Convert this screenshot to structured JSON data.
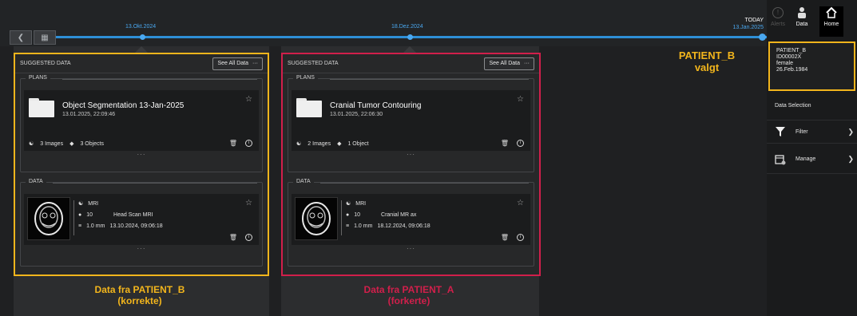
{
  "timeline": {
    "date_1": "13.Okt.2024",
    "date_2": "18.Dez.2024",
    "today_label": "TODAY",
    "today_date": "13.Jan.2025"
  },
  "topnav": {
    "alerts": "Alerts",
    "data": "Data",
    "home": "Home"
  },
  "patient": {
    "name": "PATIENT_B",
    "id": "ID00002X",
    "sex": "female",
    "dob": "26.Feb.1984"
  },
  "right_menu": {
    "data_selection": "Data Selection",
    "filter": "Filter",
    "manage": "Manage"
  },
  "panels": [
    {
      "header": "SUGGESTED DATA",
      "see_all": "See All Data",
      "plans_title": "PLANS",
      "plan_title": "Object Segmentation 13-Jan-2025",
      "plan_date": "13.01.2025, 22:09:46",
      "plan_images": "3 Images",
      "plan_objects": "3 Objects",
      "data_title": "DATA",
      "modality": "MRI",
      "count": "10",
      "series_name": "Head Scan MRI",
      "thickness": "1.0 mm",
      "series_date": "13.10.2024, 09:06:18"
    },
    {
      "header": "SUGGESTED DATA",
      "see_all": "See All Data",
      "plans_title": "PLANS",
      "plan_title": "Cranial Tumor Contouring",
      "plan_date": "13.01.2025, 22:06:30",
      "plan_images": "2 Images",
      "plan_objects": "1 Object",
      "data_title": "DATA",
      "modality": "MRI",
      "count": "10",
      "series_name": "Cranial MR ax",
      "thickness": "1.0 mm",
      "series_date": "18.12.2024, 09:06:18"
    }
  ],
  "annotations": {
    "patient_b_selected_1": "PATIENT_B",
    "patient_b_selected_2": "valgt",
    "left_1": "Data fra PATIENT_B",
    "left_2": "(korrekte)",
    "right_1": "Data fra PATIENT_A",
    "right_2": "(forkerte)"
  },
  "colors": {
    "highlight_correct": "#f2b51c",
    "highlight_wrong": "#d11f4b",
    "timeline": "#2e8fd6"
  }
}
